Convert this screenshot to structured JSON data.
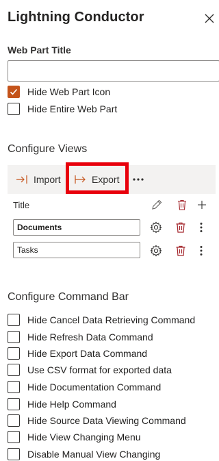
{
  "panel": {
    "title": "Lightning Conductor"
  },
  "web_part_title": {
    "label": "Web Part Title",
    "value": ""
  },
  "options": [
    {
      "label": "Hide Web Part Icon",
      "checked": true
    },
    {
      "label": "Hide Entire Web Part",
      "checked": false
    }
  ],
  "configure_views": {
    "heading": "Configure Views",
    "toolbar": {
      "import_label": "Import",
      "export_label": "Export",
      "more_icon": "more-icon"
    },
    "columns": {
      "title": "Title"
    },
    "views": [
      {
        "name": "Documents"
      },
      {
        "name": "Tasks"
      }
    ]
  },
  "command_bar": {
    "heading": "Configure Command Bar",
    "items": [
      {
        "label": "Hide Cancel Data Retrieving Command",
        "checked": false
      },
      {
        "label": "Hide Refresh Data Command",
        "checked": false
      },
      {
        "label": "Hide Export Data Command",
        "checked": false
      },
      {
        "label": "Use CSV format for exported data",
        "checked": false
      },
      {
        "label": "Hide Documentation Command",
        "checked": false
      },
      {
        "label": "Hide Help Command",
        "checked": false
      },
      {
        "label": "Hide Source Data Viewing Command",
        "checked": false
      },
      {
        "label": "Hide View Changing Menu",
        "checked": false
      },
      {
        "label": "Disable Manual View Changing",
        "checked": false
      }
    ]
  },
  "colors": {
    "accent": "#c4531a",
    "delete_icon": "#a4262c",
    "highlight": "#e8000b"
  }
}
